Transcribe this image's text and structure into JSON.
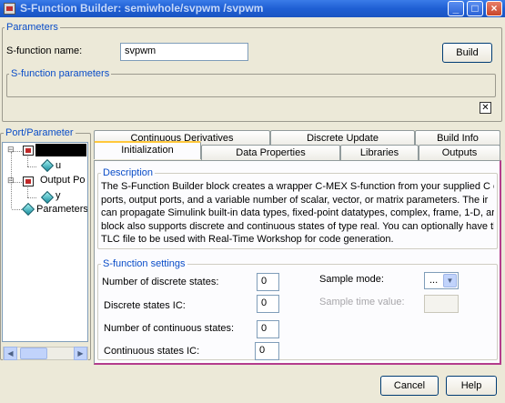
{
  "window": {
    "title": "S-Function Builder: semiwhole/svpwm  /svpwm",
    "buttons": [
      "_",
      "□",
      "×"
    ]
  },
  "parameters": {
    "legend": "Parameters",
    "name_label": "S-function name:",
    "name_value": "svpwm",
    "build_label": "Build",
    "sfparams_legend": "S-function parameters",
    "close_glyph": "✕"
  },
  "tree": {
    "legend": "Port/Parameter",
    "items": [
      {
        "label": ""
      },
      {
        "label": "u"
      },
      {
        "label": "Output Po"
      },
      {
        "label": "y"
      },
      {
        "label": "Parameters"
      }
    ]
  },
  "tabs": {
    "row1": [
      "Continuous Derivatives",
      "Discrete Update",
      "Build Info"
    ],
    "row2": [
      "Initialization",
      "Data Properties",
      "Libraries",
      "Outputs"
    ],
    "active": "Initialization"
  },
  "description": {
    "legend": "Description",
    "lines": [
      "The S-Function Builder block creates a wrapper C-MEX S-function from your supplied C coc",
      "ports, output ports, and a variable number of scalar, vector, or matrix parameters. The ir",
      "can propagate Simulink built-in data types, fixed-point datatypes, complex, frame, 1-D, ar",
      "block also supports discrete and continuous states of type real. You can optionally have tl",
      "TLC file to be used with Real-Time Workshop for code generation."
    ]
  },
  "settings": {
    "legend": "S-function settings",
    "discrete_states_label": "Number of discrete states:",
    "discrete_states_value": "0",
    "discrete_ic_label": "Discrete states IC:",
    "discrete_ic_value": "0",
    "continuous_states_label": "Number of continuous states:",
    "continuous_states_value": "0",
    "continuous_ic_label": "Continuous states IC:",
    "continuous_ic_value": "0",
    "sample_mode_label": "Sample mode:",
    "sample_mode_value": "...",
    "sample_time_label": "Sample time value:",
    "sample_time_value": ""
  },
  "footer": {
    "cancel_label": "Cancel",
    "help_label": "Help"
  }
}
